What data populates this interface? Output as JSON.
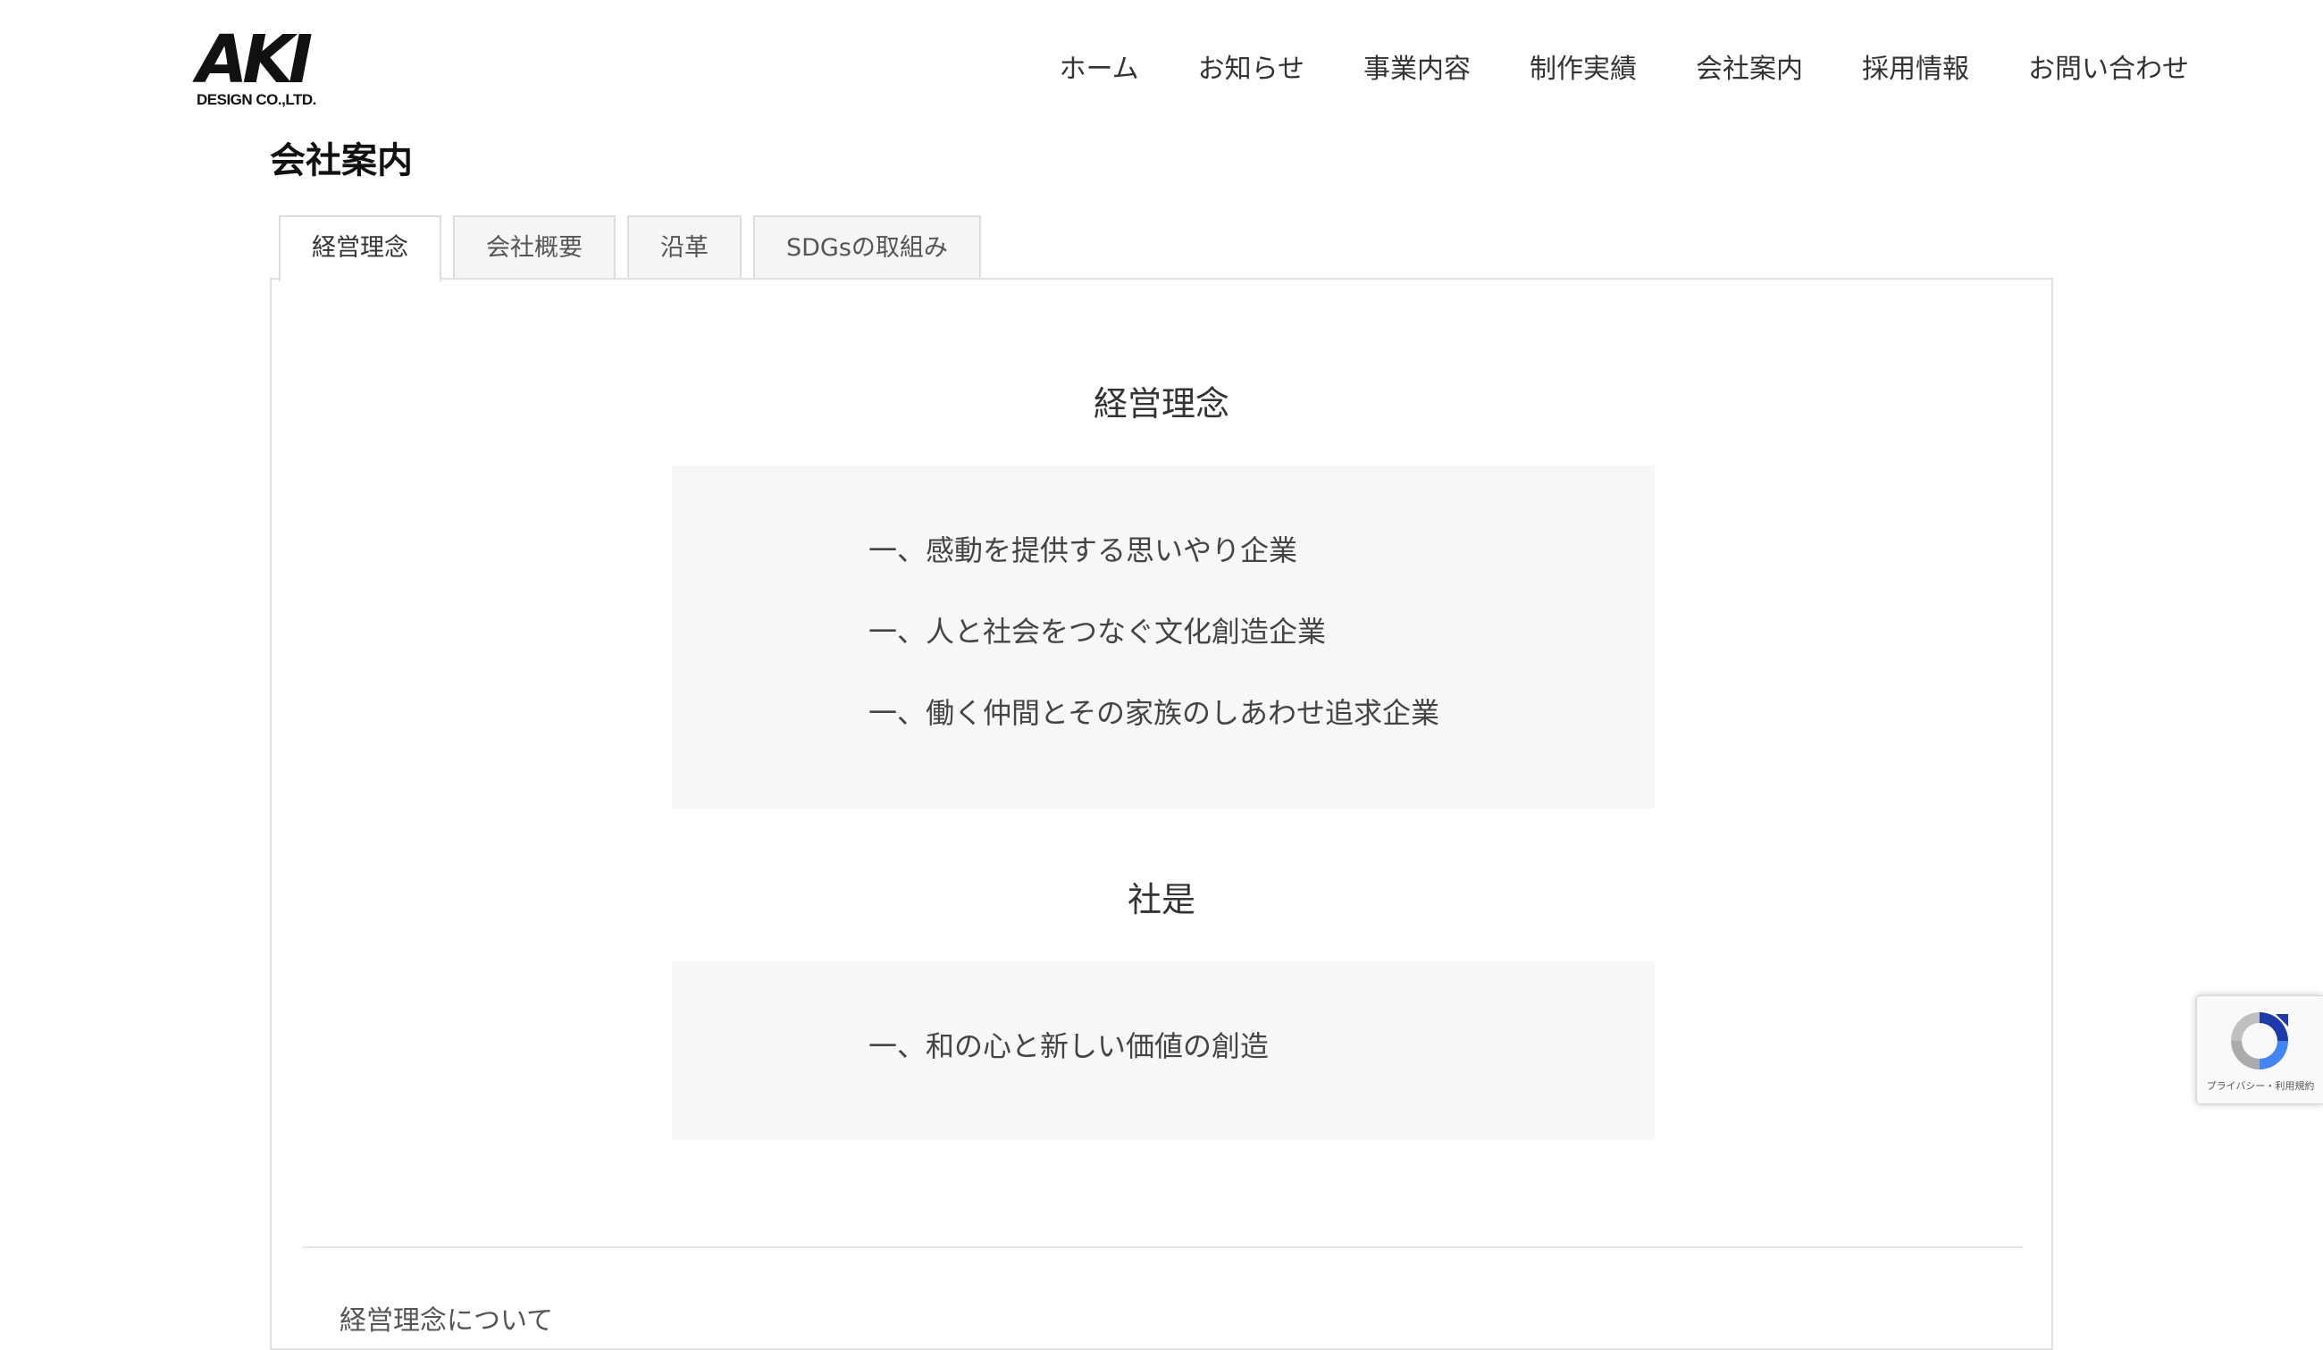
{
  "header": {
    "logo": {
      "mark": "AKI",
      "sub": "DESIGN CO.,LTD."
    },
    "nav": [
      {
        "label": "ホーム"
      },
      {
        "label": "お知らせ"
      },
      {
        "label": "事業内容"
      },
      {
        "label": "制作実績"
      },
      {
        "label": "会社案内"
      },
      {
        "label": "採用情報"
      },
      {
        "label": "お問い合わせ"
      }
    ]
  },
  "page": {
    "title": "会社案内"
  },
  "tabs": [
    {
      "label": "経営理念",
      "active": true
    },
    {
      "label": "会社概要",
      "active": false
    },
    {
      "label": "沿革",
      "active": false
    },
    {
      "label": "SDGsの取組み",
      "active": false
    }
  ],
  "philosophy": {
    "heading": "経営理念",
    "items": [
      "一、感動を提供する思いやり企業",
      "一、人と社会をつなぐ文化創造企業",
      "一、働く仲間とその家族のしあわせ追求企業"
    ]
  },
  "motto": {
    "heading": "社是",
    "items": [
      "一、和の心と新しい価値の創造"
    ]
  },
  "about": {
    "heading": "経営理念について"
  },
  "recaptcha": {
    "links": "プライバシー・利用規約"
  },
  "colors": {
    "box_bg": "#f7f7f7",
    "border": "#dddddd",
    "text": "#333333"
  }
}
